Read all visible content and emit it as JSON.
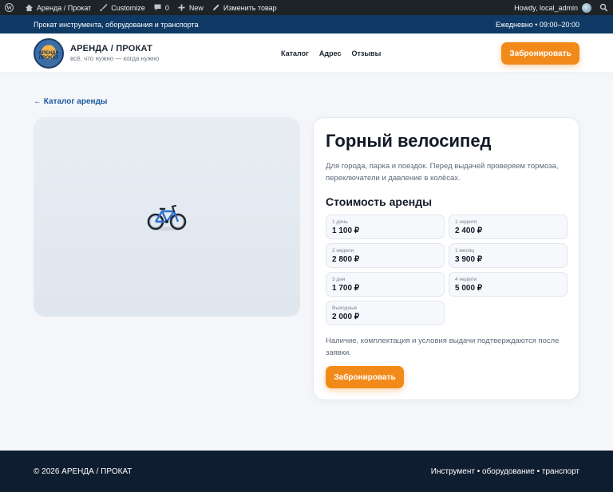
{
  "admin_bar": {
    "site": "Аренда / Прокат",
    "customize": "Customize",
    "comments_count": "0",
    "new": "New",
    "edit": "Изменить товар",
    "howdy": "Howdy, local_admin"
  },
  "topbar": {
    "left": "Прокат инструмента, оборудования и транспорта",
    "right": "Ежедневно • 09:00–20:00"
  },
  "header": {
    "logo_text": "АРЕНДА ПРОКАТ",
    "brand_name": "АРЕНДА / ПРОКАТ",
    "tagline": "всё, что нужно — когда нужно",
    "nav": [
      "Каталог",
      "Адрес",
      "Отзывы"
    ],
    "cta": "Забронировать"
  },
  "page": {
    "back_link": "← Каталог аренды",
    "product_icon": "bicycle-icon",
    "title": "Горный велосипед",
    "description": "Для города, парка и поездок. Перед выдачей проверяем тормоза, переключатели и давление в колёсах.",
    "prices_heading": "Стоимость аренды",
    "prices": [
      {
        "period": "1 день",
        "price": "1 100 ₽"
      },
      {
        "period": "1 неделя",
        "price": "2 400 ₽"
      },
      {
        "period": "2 недели",
        "price": "2 800 ₽"
      },
      {
        "period": "1 месяц",
        "price": "3 900 ₽"
      },
      {
        "period": "3 дня",
        "price": "1 700 ₽"
      },
      {
        "period": "4 недели",
        "price": "5 000 ₽"
      },
      {
        "period": "Выходные",
        "price": "2 000 ₽"
      }
    ],
    "note": "Наличие, комплектация и условия выдачи подтверждаются после заявки.",
    "cta": "Забронировать"
  },
  "footer": {
    "copyright": "© 2026 АРЕНДА / ПРОКАТ",
    "right": "Инструмент • оборудование • транспорт"
  },
  "colors": {
    "accent": "#f28a1a",
    "topbar": "#0f3a66",
    "footer": "#0f1d30",
    "link": "#1b5aa0"
  }
}
